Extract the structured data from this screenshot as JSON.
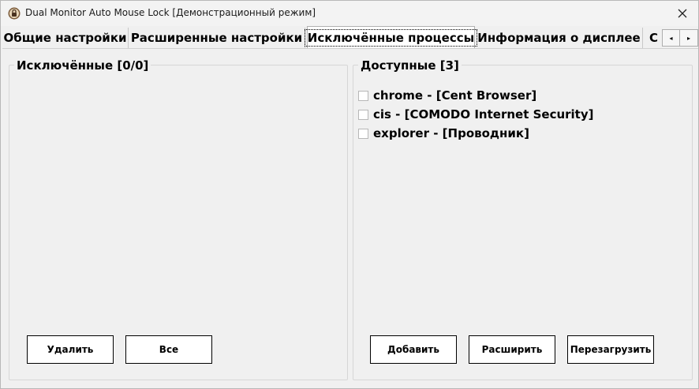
{
  "window": {
    "title": "Dual Monitor Auto Mouse Lock [Демонстрационный режим]",
    "icon": "app-lock-icon"
  },
  "tabs": [
    {
      "label": "Общие настройки"
    },
    {
      "label": "Расширенные настройки"
    },
    {
      "label": "Исключённые процессы",
      "active": true
    },
    {
      "label": "Информация о дисплее"
    },
    {
      "label": "С"
    }
  ],
  "tab_scroll": {
    "left": "◂",
    "right": "▸"
  },
  "excluded": {
    "legend": "Исключённые [0/0]",
    "delete_label": "Удалить",
    "all_label": "Все"
  },
  "available": {
    "legend": "Доступные [3]",
    "items": [
      {
        "label": "chrome - [Cent Browser]",
        "checked": false
      },
      {
        "label": "cis - [COMODO Internet Security]",
        "checked": false
      },
      {
        "label": "explorer - [Проводник]",
        "checked": false
      }
    ],
    "add_label": "Добавить",
    "expand_label": "Расширить",
    "reload_label": "Перезагрузить"
  },
  "colors": {
    "background": "#f0f0f0",
    "active_tab": "#ffffff",
    "border": "#d6d6d6"
  }
}
